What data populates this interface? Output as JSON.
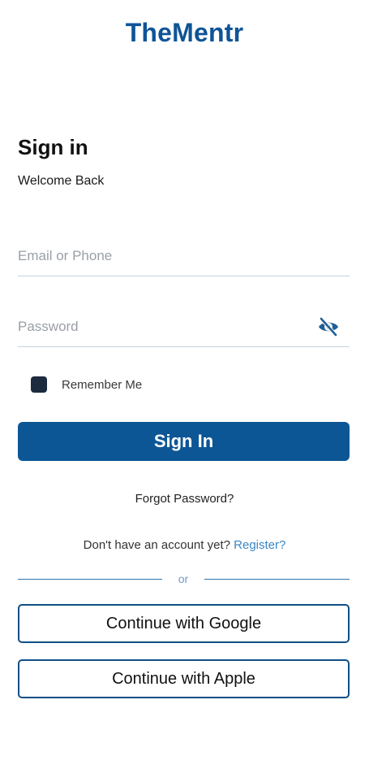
{
  "app": {
    "title": "TheMentr"
  },
  "signin": {
    "heading": "Sign in",
    "subheading": "Welcome Back",
    "email_placeholder": "Email or Phone",
    "email_value": "",
    "password_placeholder": "Password",
    "password_value": "",
    "password_toggle_icon": "eye-off-icon",
    "remember_label": "Remember Me",
    "remember_checked": false,
    "submit_label": "Sign In",
    "forgot_label": "Forgot Password?",
    "no_account_text": "Don't have an account yet? ",
    "register_label": "Register?",
    "divider_text": "or",
    "google_label": "Continue with Google",
    "apple_label": "Continue with Apple"
  },
  "colors": {
    "brand": "#0f5497",
    "primary_button": "#0d5696",
    "link": "#3a86c4",
    "divider": "#2f74ad",
    "checkbox": "#1d2b3e"
  }
}
